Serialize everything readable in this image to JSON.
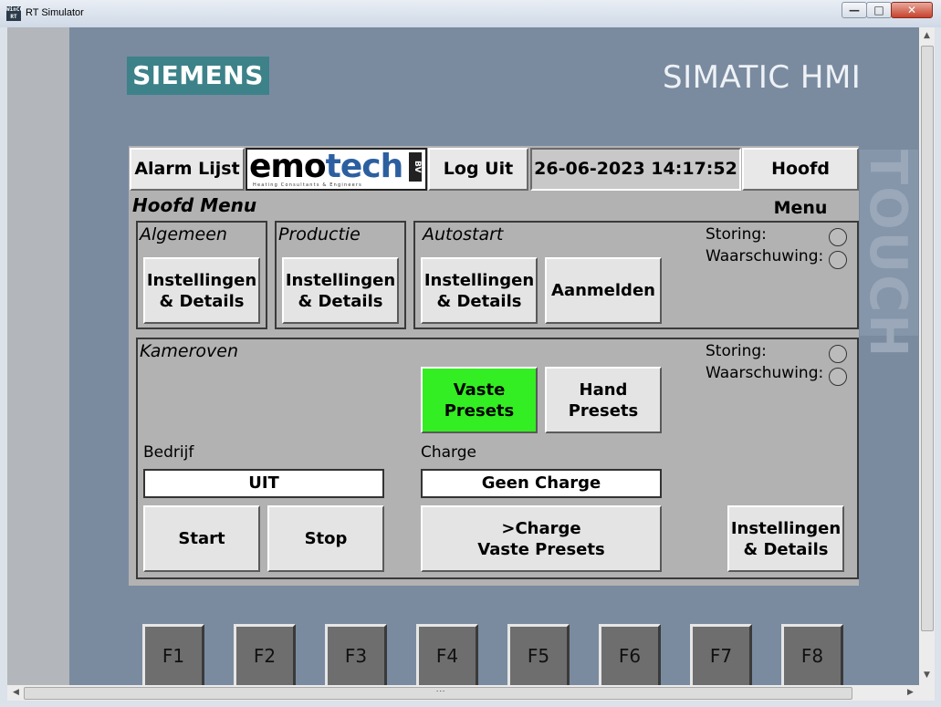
{
  "window": {
    "title": "RT Simulator",
    "icon_text": "WinCC RT",
    "minimize_glyph": "—",
    "maximize_glyph": "□",
    "close_glyph": "✕"
  },
  "brand": {
    "siemens": "SIEMENS",
    "hmi": "SIMATIC HMI",
    "touch": "TOUCH"
  },
  "topbar": {
    "alarm_list": "Alarm Lijst",
    "logo": {
      "word_emo": "emo",
      "word_tech": "tech",
      "bv": "BV",
      "tagline": "Heating Consultants & Engineers"
    },
    "logout": "Log Uit",
    "datetime": "26-06-2023 14:17:52",
    "main_menu": "Hoofd Menu"
  },
  "page_title": "Hoofd Menu",
  "algemeen": {
    "title": "Algemeen",
    "settings_line1": "Instellingen",
    "settings_line2": "& Details"
  },
  "productie": {
    "title": "Productie",
    "settings_line1": "Instellingen",
    "settings_line2": "& Details"
  },
  "autostart": {
    "title": "Autostart",
    "settings_line1": "Instellingen",
    "settings_line2": "& Details",
    "login": "Aanmelden",
    "storing": "Storing:",
    "waarschuwing": "Waarschuwing:"
  },
  "kameroven": {
    "title": "Kameroven",
    "storing": "Storing:",
    "waarschuwing": "Waarschuwing:",
    "fixed_presets_line1": "Vaste",
    "fixed_presets_line2": "Presets",
    "hand_presets_line1": "Hand",
    "hand_presets_line2": "Presets",
    "company_label": "Bedrijf",
    "company_value": "UIT",
    "charge_label": "Charge",
    "charge_value": "Geen Charge",
    "start": "Start",
    "stop": "Stop",
    "charge_presets_line1": ">Charge",
    "charge_presets_line2": "Vaste Presets",
    "settings_line1": "Instellingen",
    "settings_line2": "& Details"
  },
  "fkeys": [
    "F1",
    "F2",
    "F3",
    "F4",
    "F5",
    "F6",
    "F7",
    "F8"
  ],
  "colors": {
    "active_preset": "#33ee22",
    "siemens_teal": "#3d8289",
    "emotech_blue": "#2c5fa0",
    "device_bezel": "#7a8ba0"
  },
  "icons": {
    "scroll_up": "▲",
    "scroll_down": "▼",
    "scroll_left": "◀",
    "scroll_right": "▶",
    "grip": "⋮"
  }
}
